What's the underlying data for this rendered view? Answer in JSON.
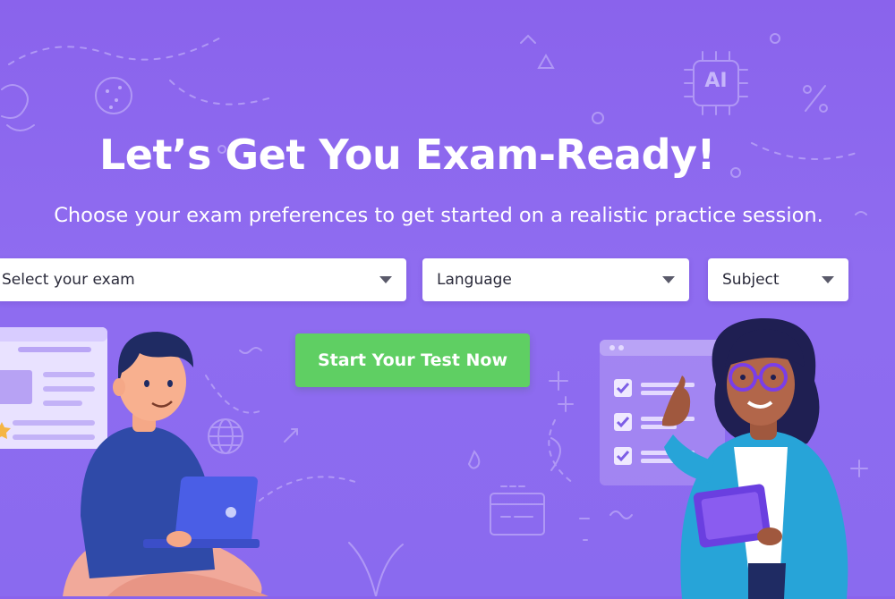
{
  "hero": {
    "title": "Let’s Get You Exam-Ready!",
    "subtitle": "Choose your exam preferences to get started on a realistic practice session."
  },
  "form": {
    "exam_select": {
      "selected": "Select your exam"
    },
    "language_select": {
      "selected": "Language"
    },
    "subject_select": {
      "selected": "Subject"
    },
    "start_button": "Start Your Test Now"
  },
  "decor": {
    "chip_label": "AI",
    "percent_symbol": "%"
  },
  "colors": {
    "background": "#8b66ee",
    "button": "#5fcf63",
    "text": "#ffffff"
  }
}
